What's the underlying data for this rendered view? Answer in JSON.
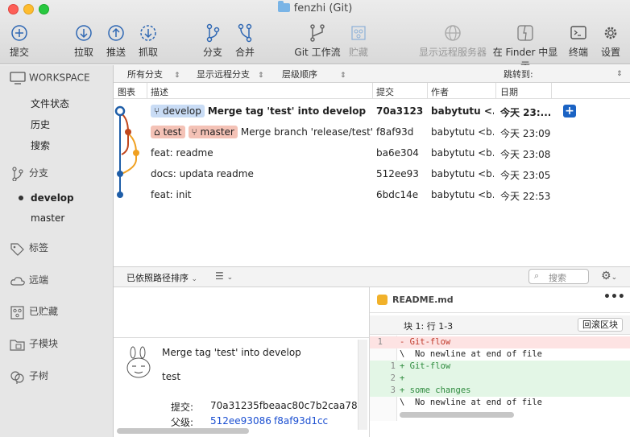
{
  "window": {
    "title": "fenzhi (Git)"
  },
  "toolbar": {
    "commit": "提交",
    "pull": "拉取",
    "push": "推送",
    "fetch": "抓取",
    "branch": "分支",
    "merge": "合并",
    "gitflow": "Git 工作流",
    "stash": "贮藏",
    "show_remote": "显示远程服务器",
    "finder": "在 Finder 中显示",
    "terminal": "终端",
    "settings": "设置"
  },
  "sidebar": {
    "workspace": "WORKSPACE",
    "workspace_items": [
      "文件状态",
      "历史",
      "搜索"
    ],
    "branches": "分支",
    "branch_items": [
      "develop",
      "master"
    ],
    "tags": "标签",
    "remotes": "远端",
    "stashes": "已贮藏",
    "submodules": "子模块",
    "subtrees": "子树"
  },
  "filters": {
    "all_branches": "所有分支",
    "show_remote": "显示远程分支",
    "order": "层级顺序",
    "jump": "跳转到:"
  },
  "columns": {
    "graph": "图表",
    "desc": "描述",
    "commit": "提交",
    "author": "作者",
    "date": "日期"
  },
  "commits": [
    {
      "tags": [
        {
          "type": "branch",
          "label": "develop"
        }
      ],
      "desc": "Merge tag 'test' into develop",
      "hash": "70a3123",
      "author": "babytutu <...",
      "date": "今天 23:..."
    },
    {
      "tags": [
        {
          "type": "tag",
          "label": "test"
        },
        {
          "type": "branch",
          "label": "master"
        }
      ],
      "desc": "Merge branch 'release/test'",
      "hash": "f8af93d",
      "author": "babytutu <b...",
      "date": "今天 23:09"
    },
    {
      "tags": [],
      "desc": "feat: readme",
      "hash": "ba6e304",
      "author": "babytutu <b...",
      "date": "今天 23:08"
    },
    {
      "tags": [],
      "desc": "docs: updata readme",
      "hash": "512ee93",
      "author": "babytutu <b...",
      "date": "今天 23:05"
    },
    {
      "tags": [],
      "desc": "feat: init",
      "hash": "6bdc14e",
      "author": "babytutu <b...",
      "date": "今天 22:53"
    }
  ],
  "lower": {
    "sort": "已依照路径排序",
    "search_placeholder": "搜索"
  },
  "detail": {
    "message": "Merge tag 'test' into develop",
    "subject": "test",
    "commit_label": "提交:",
    "commit_value": "70a31235fbeaac80c7b2caa784",
    "parents_label": "父级:",
    "parent1": "512ee93086",
    "parent2": "f8af93d1cc"
  },
  "diff": {
    "file": "README.md",
    "hunk_label": "块 1:  行 1-3",
    "revert": "回滚区块",
    "lines": [
      {
        "kind": "del",
        "n1": "1",
        "n2": "",
        "text": "- Git-flow"
      },
      {
        "kind": "meta",
        "n1": "",
        "n2": "",
        "text": "\\  No newline at end of file"
      },
      {
        "kind": "add",
        "n1": "",
        "n2": "1",
        "text": "+ Git-flow"
      },
      {
        "kind": "add",
        "n1": "",
        "n2": "2",
        "text": "+"
      },
      {
        "kind": "add",
        "n1": "",
        "n2": "3",
        "text": "+ some changes"
      },
      {
        "kind": "meta",
        "n1": "",
        "n2": "",
        "text": "\\  No newline at end of file"
      }
    ]
  },
  "colors": {
    "accent": "#1b63c4",
    "graph_blue": "#1f5ea8",
    "graph_red": "#c0461c",
    "graph_orange": "#f0a020"
  }
}
